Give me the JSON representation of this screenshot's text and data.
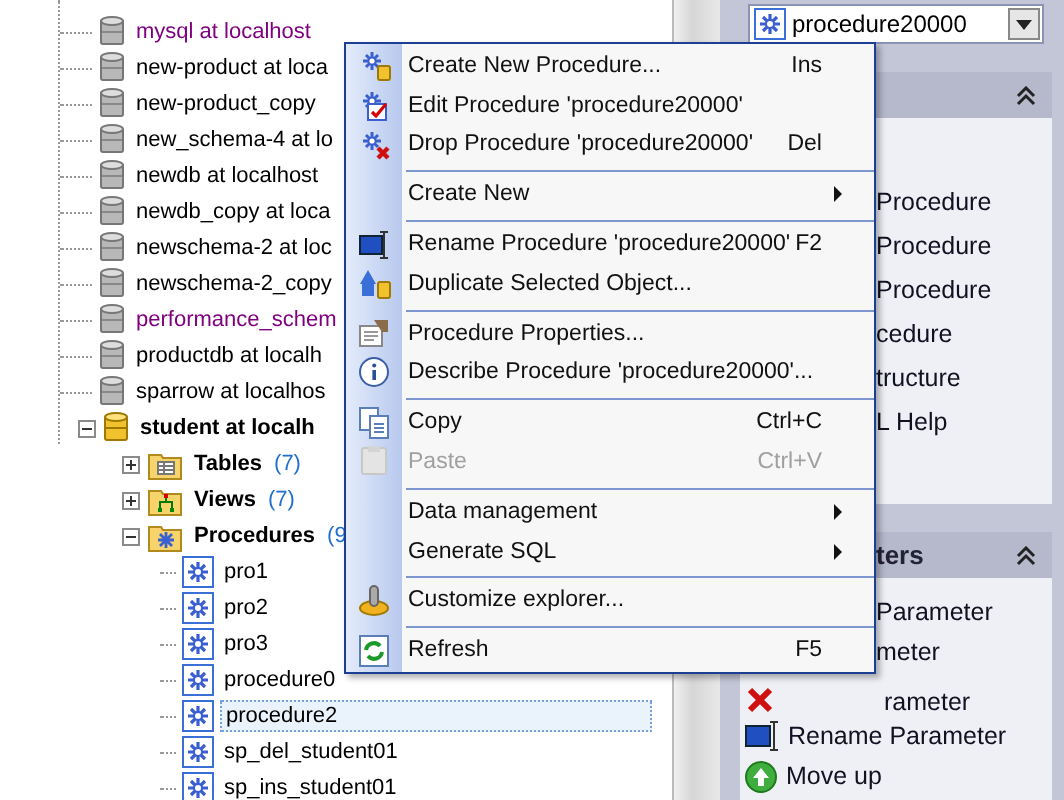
{
  "tree": {
    "databases": [
      {
        "label": "mysql at localhost",
        "color": "#800080",
        "connected": false
      },
      {
        "label": "new-product at loca",
        "color": "#000000",
        "connected": false
      },
      {
        "label": "new-product_copy",
        "color": "#000000",
        "connected": false
      },
      {
        "label": "new_schema-4 at lo",
        "color": "#000000",
        "connected": false
      },
      {
        "label": "newdb at localhost",
        "color": "#000000",
        "connected": false
      },
      {
        "label": "newdb_copy at loca",
        "color": "#000000",
        "connected": false
      },
      {
        "label": "newschema-2 at loc",
        "color": "#000000",
        "connected": false
      },
      {
        "label": "newschema-2_copy",
        "color": "#000000",
        "connected": false
      },
      {
        "label": "performance_schem",
        "color": "#800080",
        "connected": false
      },
      {
        "label": "productdb at localh",
        "color": "#000000",
        "connected": false
      },
      {
        "label": "sparrow at localhos",
        "color": "#000000",
        "connected": false
      },
      {
        "label": "student at localh",
        "color": "#000000",
        "connected": true,
        "expanded": true,
        "children": [
          {
            "label": "Tables",
            "count": "(7)",
            "kind": "tables",
            "expanded": false
          },
          {
            "label": "Views",
            "count": "(7)",
            "kind": "views",
            "expanded": false
          },
          {
            "label": "Procedures",
            "count": "(9",
            "kind": "procedures",
            "expanded": true,
            "children": [
              {
                "label": "pro1",
                "selected": false
              },
              {
                "label": "pro2",
                "selected": false
              },
              {
                "label": "pro3",
                "selected": false
              },
              {
                "label": "procedure0",
                "selected": false
              },
              {
                "label": "procedure2",
                "selected": true
              },
              {
                "label": "sp_del_student01",
                "selected": false
              },
              {
                "label": "sp_ins_student01",
                "selected": false
              }
            ]
          }
        ]
      }
    ]
  },
  "context_menu": [
    {
      "kind": "create",
      "label": "Create New Procedure...",
      "shortcut": "Ins",
      "submenu": false,
      "disabled": false
    },
    {
      "kind": "edit",
      "label": "Edit Procedure 'procedure20000'",
      "submenu": false,
      "disabled": false
    },
    {
      "kind": "drop",
      "label": "Drop Procedure 'procedure20000'",
      "shortcut": "Del",
      "submenu": false,
      "disabled": false
    },
    {
      "kind": "separator"
    },
    {
      "kind": "none",
      "label": "Create New",
      "submenu": true,
      "disabled": false
    },
    {
      "kind": "separator"
    },
    {
      "kind": "rename",
      "label": "Rename Procedure 'procedure20000'",
      "shortcut": "F2",
      "submenu": false,
      "disabled": false
    },
    {
      "kind": "duplicate",
      "label": "Duplicate Selected Object...",
      "submenu": false,
      "disabled": false
    },
    {
      "kind": "separator"
    },
    {
      "kind": "properties",
      "label": "Procedure Properties...",
      "submenu": false,
      "disabled": false
    },
    {
      "kind": "info",
      "label": "Describe Procedure 'procedure20000'...",
      "submenu": false,
      "disabled": false
    },
    {
      "kind": "separator"
    },
    {
      "kind": "copy",
      "label": "Copy",
      "shortcut": "Ctrl+C",
      "submenu": false,
      "disabled": false
    },
    {
      "kind": "paste",
      "label": "Paste",
      "shortcut": "Ctrl+V",
      "submenu": false,
      "disabled": true
    },
    {
      "kind": "separator"
    },
    {
      "kind": "none",
      "label": "Data management",
      "submenu": true,
      "disabled": false
    },
    {
      "kind": "none",
      "label": "Generate SQL",
      "submenu": true,
      "disabled": false
    },
    {
      "kind": "separator"
    },
    {
      "kind": "customize",
      "label": "Customize explorer...",
      "submenu": false,
      "disabled": false
    },
    {
      "kind": "separator"
    },
    {
      "kind": "refresh",
      "label": "Refresh",
      "shortcut": "F5",
      "submenu": false,
      "disabled": false
    }
  ],
  "object_selector": {
    "value": "procedure20000"
  },
  "panels": [
    {
      "items": [
        {
          "kind": "text",
          "label": "Procedure"
        },
        {
          "kind": "text",
          "label": "Procedure"
        },
        {
          "kind": "text",
          "label": "Procedure"
        },
        {
          "kind": "text",
          "label": "cedure"
        },
        {
          "kind": "text",
          "label": "tructure"
        },
        {
          "kind": "text",
          "label": "L Help"
        }
      ]
    },
    {
      "title": "ters",
      "items": [
        {
          "kind": "text",
          "label": "Parameter"
        },
        {
          "kind": "text",
          "label": "meter"
        },
        {
          "kind": "drop",
          "label": "rameter"
        },
        {
          "kind": "rename",
          "label": "Rename Parameter"
        },
        {
          "kind": "move-up",
          "label": "Move up"
        }
      ]
    }
  ]
}
